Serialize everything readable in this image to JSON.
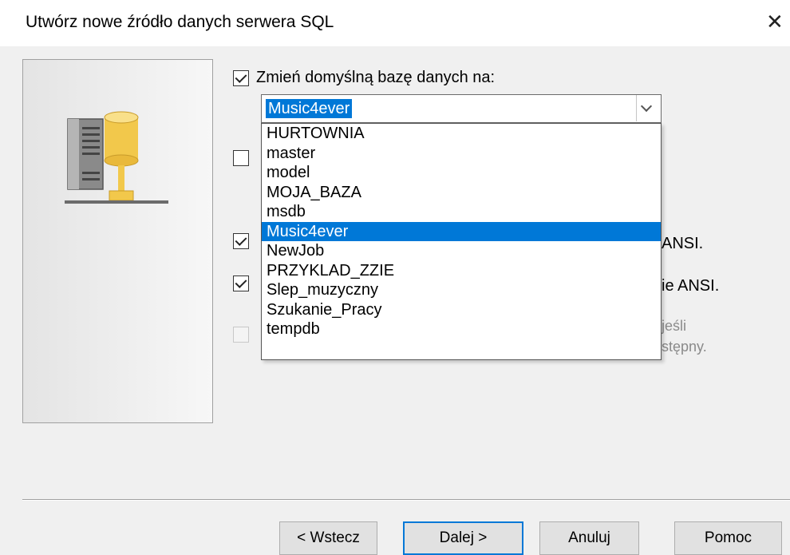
{
  "window": {
    "title": "Utwórz nowe źródło danych serwera SQL",
    "close_glyph": "✕"
  },
  "options": {
    "change_default_db": {
      "label": "Zmień domyślną bazę danych na:",
      "checked": true
    },
    "option2": {
      "label_fragment": "",
      "checked": false
    },
    "option3": {
      "label_fragment": "ANSI.",
      "checked": true
    },
    "option4": {
      "label_fragment": "ie ANSI.",
      "checked": true
    },
    "option5": {
      "label_line1": "jeśli",
      "label_line2": "stępny.",
      "checked": false,
      "disabled": true
    }
  },
  "database_combo": {
    "selected_value": "Music4ever",
    "items": [
      "HURTOWNIA",
      "master",
      "model",
      "MOJA_BAZA",
      "msdb",
      "Music4ever",
      "NewJob",
      "PRZYKLAD_ZZIE",
      "Slep_muzyczny",
      "Szukanie_Pracy",
      "tempdb"
    ],
    "highlighted_index": 5
  },
  "buttons": {
    "back": "< Wstecz",
    "next": "Dalej >",
    "cancel": "Anuluj",
    "help": "Pomoc"
  },
  "colors": {
    "accent": "#0078d7",
    "dialog_bg": "#f0f0f0"
  },
  "icons": {
    "side_image": "database-server-icon",
    "combo_arrow": "chevron-down-icon",
    "close": "close-icon"
  }
}
